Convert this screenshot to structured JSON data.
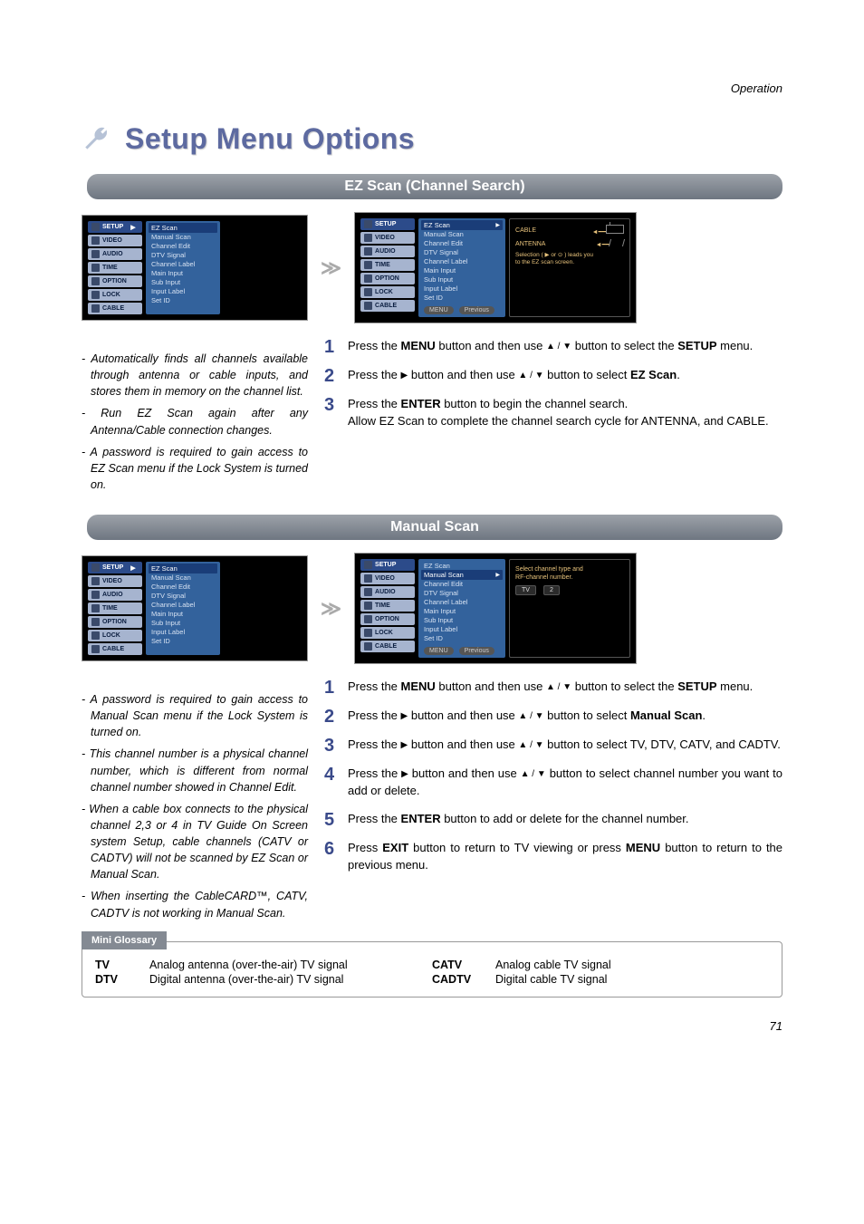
{
  "header": {
    "section": "Operation"
  },
  "title": "Setup Menu Options",
  "sections": {
    "ez": {
      "bar": "EZ Scan (Channel Search)"
    },
    "ms": {
      "bar": "Manual Scan"
    }
  },
  "osd": {
    "tabs": [
      "SETUP",
      "VIDEO",
      "AUDIO",
      "TIME",
      "OPTION",
      "LOCK",
      "CABLE"
    ],
    "tab_arrow": "▶",
    "items": [
      "EZ Scan",
      "Manual Scan",
      "Channel Edit",
      "DTV Signal",
      "Channel Label",
      "Main Input",
      "Sub Input",
      "Input Label",
      "Set ID"
    ],
    "tri": "▶",
    "foot_menu": "MENU",
    "foot_prev": "Previous",
    "ez_right": {
      "cable": "CABLE",
      "antenna": "ANTENNA",
      "note1": "Selection ( ▶ or ⊙ ) leads you",
      "note2": "to the EZ scan screen."
    },
    "ms_right": {
      "line1": "Select channel type and",
      "line2": "RF-channel number.",
      "chip1": "TV",
      "chip2": "2"
    }
  },
  "ez_notes": [
    "- Automatically finds all channels available through antenna or cable inputs, and stores them in memory on the channel list.",
    "- Run EZ Scan again after any Antenna/Cable connection changes.",
    "- A password is required to gain access to EZ Scan menu if the Lock System is turned on."
  ],
  "ez_steps": {
    "n1": "1",
    "s1a": "Press the ",
    "s1b": "MENU",
    "s1c": " button and then use ",
    "s1d": "▲ / ▼",
    "s1e": "  button to select the ",
    "s1f": "SETUP",
    "s1g": " menu.",
    "n2": "2",
    "s2a": "Press the ",
    "s2b": "▶",
    "s2c": "  button and then use ",
    "s2d": "▲  / ▼",
    "s2e": " button to select ",
    "s2f": "EZ Scan",
    "s2g": ".",
    "n3": "3",
    "s3a": "Press the ",
    "s3b": "ENTER",
    "s3c": " button to begin the channel search.",
    "s3d": "Allow EZ Scan to complete the channel search cycle for ANTENNA, and CABLE."
  },
  "ms_notes": [
    "-  A password is required to gain access to Manual Scan menu if the Lock System is turned on.",
    "- This channel number is a physical channel number, which is different from normal channel number showed in Channel Edit.",
    "- When a cable box connects to the physical channel 2,3 or 4 in TV Guide On Screen system Setup, cable channels (CATV or CADTV) will not be scanned by EZ Scan or Manual Scan.",
    "- When inserting the CableCARD™, CATV, CADTV is not working in Manual Scan."
  ],
  "ms_steps": {
    "n1": "1",
    "s1a": "Press the ",
    "s1b": "MENU",
    "s1c": " button and then use ",
    "s1d": "▲ / ▼",
    "s1e": "  button to select the ",
    "s1f": "SETUP",
    "s1g": " menu.",
    "n2": "2",
    "s2a": "Press the ",
    "s2b": "▶",
    "s2c": "  button and then use ",
    "s2d": "▲  / ▼",
    "s2e": " button to select ",
    "s2f": "Manual Scan",
    "s2g": ".",
    "n3": "3",
    "s3a": "Press the ",
    "s3b": "▶",
    "s3c": " button and then use ",
    "s3d": "▲  / ▼",
    "s3e": " button to select TV, DTV, CATV, and CADTV.",
    "n4": "4",
    "s4a": "Press the ",
    "s4b": "▶",
    "s4c": " button and then use ",
    "s4d": "▲  / ▼",
    "s4e": " button to select channel number you want to add or delete.",
    "n5": "5",
    "s5a": "Press the ",
    "s5b": "ENTER",
    "s5c": " button to add or delete for the channel number.",
    "n6": "6",
    "s6a": "Press ",
    "s6b": "EXIT",
    "s6c": " button to return to TV viewing or press ",
    "s6d": "MENU",
    "s6e": " button to return to the previous menu."
  },
  "glossary": {
    "tab": "Mini Glossary",
    "rows": [
      {
        "k": "TV",
        "v": "Analog antenna (over-the-air) TV signal"
      },
      {
        "k": "DTV",
        "v": "Digital antenna (over-the-air) TV signal"
      },
      {
        "k": "CATV",
        "v": "Analog cable TV signal"
      },
      {
        "k": "CADTV",
        "v": "Digital cable TV signal"
      }
    ]
  },
  "page_number": "71",
  "arrow": "≫"
}
